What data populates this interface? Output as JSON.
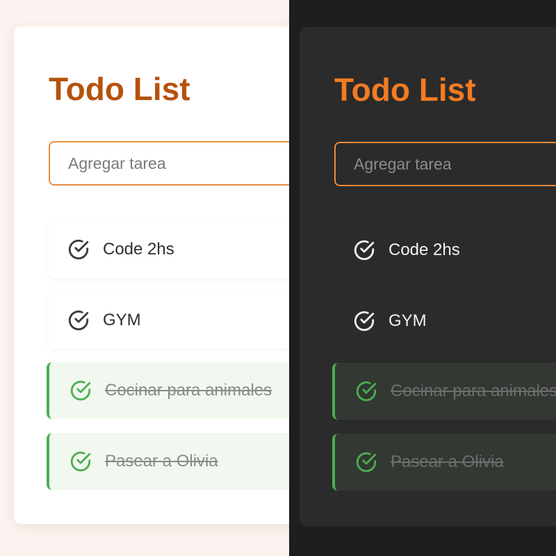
{
  "light": {
    "title": "Todo List",
    "input": {
      "placeholder": "Agregar tarea",
      "value": ""
    },
    "tasks": [
      {
        "label": "Code 2hs",
        "done": false
      },
      {
        "label": "GYM",
        "done": false
      },
      {
        "label": "Cocinar para animales",
        "done": true
      },
      {
        "label": "Pasear a Olivia",
        "done": true
      }
    ]
  },
  "dark": {
    "title": "Todo List",
    "input": {
      "placeholder": "Agregar tarea",
      "value": ""
    },
    "tasks": [
      {
        "label": "Code 2hs",
        "done": false
      },
      {
        "label": "GYM",
        "done": false
      },
      {
        "label": "Cocinar para animales",
        "done": true
      },
      {
        "label": "Pasear a Olivia",
        "done": true
      }
    ]
  },
  "colors": {
    "light_background": "#fbf3ef",
    "light_card": "#ffffff",
    "light_title": "#b5520c",
    "light_input_border": "#e58d3e",
    "dark_background": "#1e1e1e",
    "dark_card": "#2b2b2b",
    "dark_title": "#f37b22",
    "dark_input_border": "#ef8a3b",
    "done_accent": "#4caf50"
  },
  "icons": {
    "task": "check-circle-icon"
  }
}
